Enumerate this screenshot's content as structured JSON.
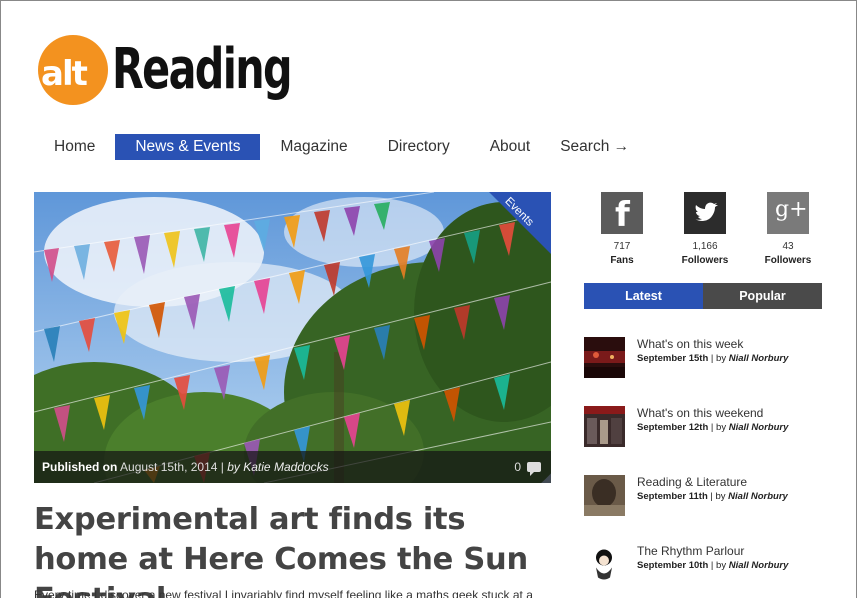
{
  "logo": {
    "prefix": "alt",
    "word": "Reading"
  },
  "nav": [
    {
      "label": "Home"
    },
    {
      "label": "News & Events"
    },
    {
      "label": "Magazine"
    },
    {
      "label": "Directory"
    },
    {
      "label": "About"
    },
    {
      "label": "Search →"
    }
  ],
  "hero": {
    "category": "Events",
    "published_label": "Published on",
    "date": "August 15th, 2014",
    "separator": "|",
    "by": "by Katie Maddocks",
    "comment_count": "0"
  },
  "post": {
    "title": "Experimental art finds its home at Here Comes the Sun Festival",
    "excerpt": "Every time I discover a new festival I invariably find myself feeling like a maths geek stuck at a"
  },
  "social": [
    {
      "icon": "facebook-icon",
      "glyph": "f",
      "count": "717",
      "label": "Fans"
    },
    {
      "icon": "twitter-icon",
      "glyph": "🐦",
      "count": "1,166",
      "label": "Followers"
    },
    {
      "icon": "google-plus-icon",
      "glyph": "g+",
      "count": "43",
      "label": "Followers"
    }
  ],
  "tabs": {
    "latest": "Latest",
    "popular": "Popular"
  },
  "latest": [
    {
      "title": "What's on this week",
      "date": "September 15th",
      "sep": "| by",
      "author": "Niall Norbury"
    },
    {
      "title": "What's on this weekend",
      "date": "September 12th",
      "sep": "| by",
      "author": "Niall Norbury"
    },
    {
      "title": "Reading & Literature",
      "date": "September 11th",
      "sep": "| by",
      "author": "Niall Norbury"
    },
    {
      "title": "The Rhythm Parlour",
      "date": "September 10th",
      "sep": "| by",
      "author": "Niall Norbury"
    }
  ],
  "colors": {
    "accent": "#2a52b4",
    "logo_orange": "#f3921f"
  }
}
